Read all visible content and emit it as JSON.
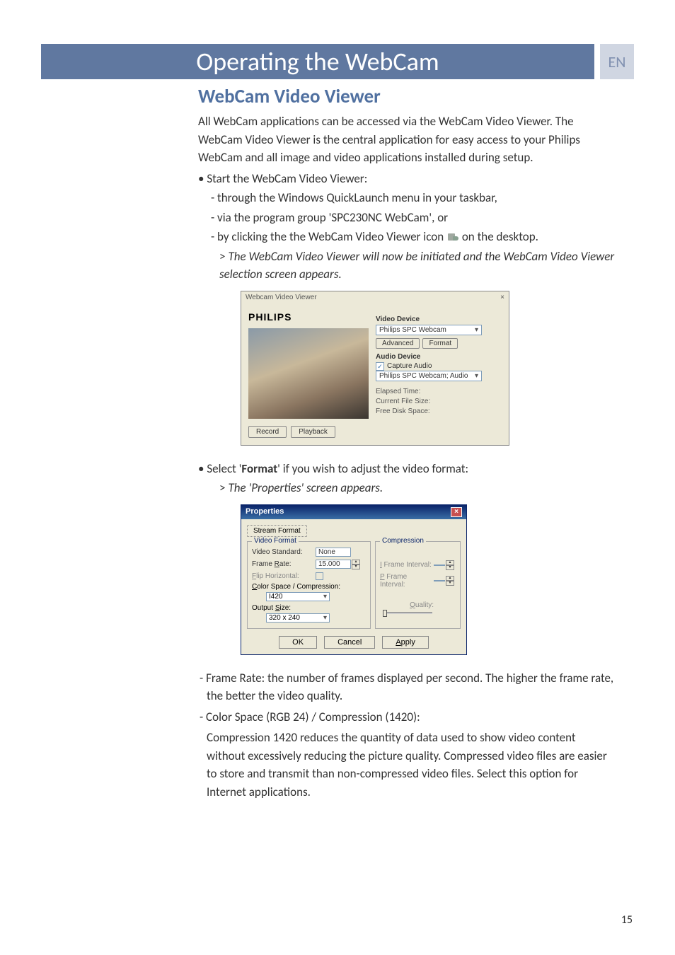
{
  "header": {
    "title": "Operating the WebCam",
    "lang": "EN"
  },
  "section": {
    "title": "WebCam Video Viewer",
    "intro": "All WebCam applications can be accessed via the WebCam Video Viewer. The WebCam Video Viewer is the central application for easy access to your Philips WebCam and all image and video applications installed during setup.",
    "bullet1": "Start the WebCam Video Viewer:",
    "dash1": "- through the Windows QuickLaunch menu in your taskbar,",
    "dash2": "- via the program group 'SPC230NC WebCam', or",
    "dash3a": "- by clicking the the WebCam Video Viewer icon",
    "dash3b": "on the desktop.",
    "result1": "The WebCam Video Viewer will now be initiated and the WebCam Video Viewer selection screen appears.",
    "bullet2a": "Select '",
    "bullet2bold": "Format",
    "bullet2b": "' if you wish to adjust the video format:",
    "result2": "The 'Properties' screen appears.",
    "frameRateLabel": "Frame Rate:",
    "frameRateText": " the number of frames displayed per second. The higher the frame rate, the better the video quality.",
    "colorSpace": "- Color Space (RGB 24) / Compression (1420):",
    "compLabel": "Compression 1420",
    "compText": " reduces the quantity of data used to show video content without excessively reducing the picture quality. Compressed video files are easier to store and transmit than non-compressed video files. Select this option for Internet applications."
  },
  "viewer": {
    "title": "Webcam Video Viewer",
    "logo": "PHILIPS",
    "record": "Record",
    "playback": "Playback",
    "videoDevice": "Video Device",
    "videoCombo": "Philips SPC Webcam",
    "advanced": "Advanced",
    "format": "Format",
    "audioDevice": "Audio Device",
    "captureAudio": "Capture Audio",
    "audioCombo": "Philips SPC Webcam; Audio",
    "elapsed": "Elapsed Time:",
    "fileSize": "Current File Size:",
    "diskSpace": "Free Disk Space:"
  },
  "props": {
    "title": "Properties",
    "tab": "Stream Format",
    "videoFormat": "Video Format",
    "compression": "Compression",
    "videoStandard": "Video Standard:",
    "none": "None",
    "frameRate": "Frame Rate:",
    "frameRateVal": "15.000",
    "flip": "Flip Horizontal:",
    "colorSpace": "Color Space / Compression:",
    "colorVal": "I420",
    "outputSize": "Output Size:",
    "outputVal": "320 x 240",
    "iFrame": "I Frame Interval:",
    "pFrame": "P Frame Interval:",
    "quality": "Quality:",
    "ok": "OK",
    "cancel": "Cancel",
    "apply": "Apply"
  },
  "pageNum": "15"
}
